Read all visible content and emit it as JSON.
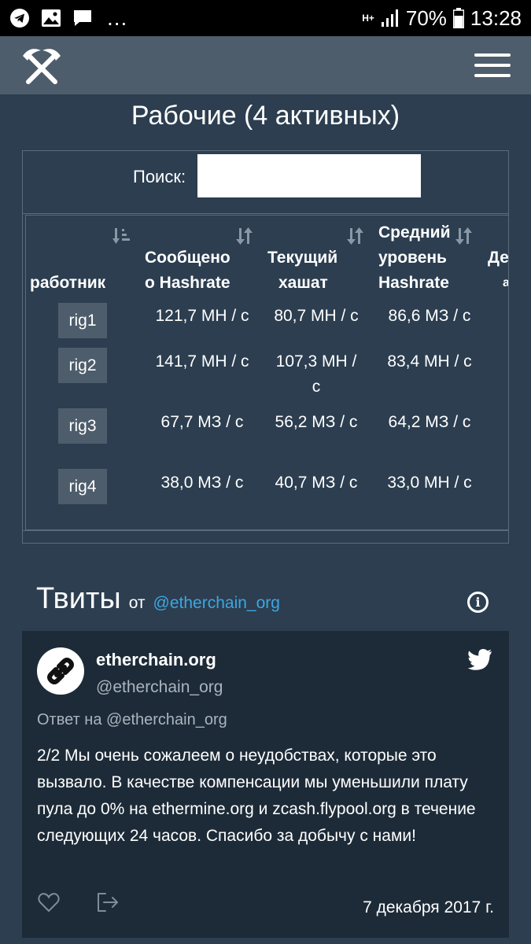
{
  "status_bar": {
    "network_type": "H+",
    "battery": "70%",
    "time": "13:28",
    "overflow": "..."
  },
  "navbar": {
    "logo_icon": "crossed-pickaxes-icon",
    "menu_icon": "hamburger-menu-icon"
  },
  "workers": {
    "title": "Рабочие (4 активных)",
    "search_label": "Поиск:",
    "search_value": "",
    "columns": {
      "worker": "работник",
      "reported_1": "Сообщено",
      "reported_2": "о Hashrate",
      "current_1": "Текущий",
      "current_2": "хашат",
      "avg_1": "Средний",
      "avg_2": "уровень",
      "avg_3": "Hashrate",
      "cut_1": "Де",
      "cut_2": "а"
    },
    "rows": [
      {
        "name": "rig1",
        "reported": "121,7 МН / с",
        "current": "80,7 МН / с",
        "average": "86,6 МЗ / с"
      },
      {
        "name": "rig2",
        "reported": "141,7 МН / с",
        "current_1": "107,3 МН /",
        "current_2": "с",
        "average": "83,4 МН / с"
      },
      {
        "name": "rig3",
        "reported": "67,7 МЗ / с",
        "current": "56,2 МЗ / с",
        "average": "64,2 МЗ / с"
      },
      {
        "name": "rig4",
        "reported": "38,0 МЗ / с",
        "current": "40,7 МЗ / с",
        "average": "33,0 МН / с"
      }
    ]
  },
  "tweets": {
    "title": "Твиты",
    "from": "от",
    "handle": "@etherchain_org",
    "tweet": {
      "name": "etherchain.org",
      "handle": "@etherchain_org",
      "reply_to": "Ответ на @etherchain_org",
      "body": "2/2 Мы очень сожалеем о неудобствах, которые это вызвало. В качестве компенсации мы уменьшили плату пула до 0% на  ethermine.org и  zcash.flypool.org в течение следующих 24 часов. Спасибо за добычу с нами!",
      "date": "7 декабря 2017 г."
    }
  },
  "colors": {
    "background": "#2c3e50",
    "navbar": "#4e5d6c",
    "link": "#3ea6e0",
    "card": "#1d2b38"
  }
}
